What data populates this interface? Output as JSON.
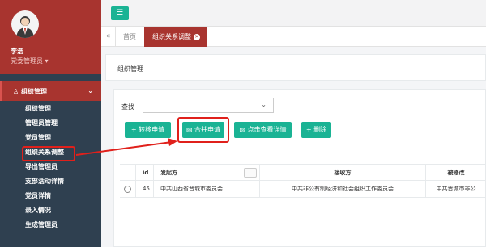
{
  "user": {
    "name": "李浩",
    "role": "党委管理员 ▾"
  },
  "sidebar": {
    "section": "组织管理",
    "items": [
      {
        "label": "组织管理"
      },
      {
        "label": "管理员管理"
      },
      {
        "label": "党员管理"
      },
      {
        "label": "组织关系调整"
      },
      {
        "label": "导出管理员"
      },
      {
        "label": "支部活动详情"
      },
      {
        "label": "党员详情"
      },
      {
        "label": "录入情况"
      },
      {
        "label": "生成管理员"
      }
    ]
  },
  "tabs": {
    "home": "首页",
    "active": "组织关系调整"
  },
  "page": {
    "title": "组织管理"
  },
  "search": {
    "label": "查找",
    "value": ""
  },
  "toolbar": {
    "transfer": "+ 转移申请",
    "merge": "合并申请",
    "view": "点击查看详情",
    "delete": "+ 删除"
  },
  "table": {
    "headers": [
      "",
      "id",
      "发起方",
      "接收方",
      "被修改"
    ],
    "rows": [
      {
        "id": "45",
        "from": "中共山西省晋城市委员会",
        "to": "中共非公有制经济和社会组织工作委员会",
        "changed": "中共晋城市非公"
      }
    ]
  },
  "colors": {
    "sidebar": "#2f4050",
    "brand": "#a8342f",
    "accent": "#1ab394",
    "highlight": "#e0201b"
  }
}
